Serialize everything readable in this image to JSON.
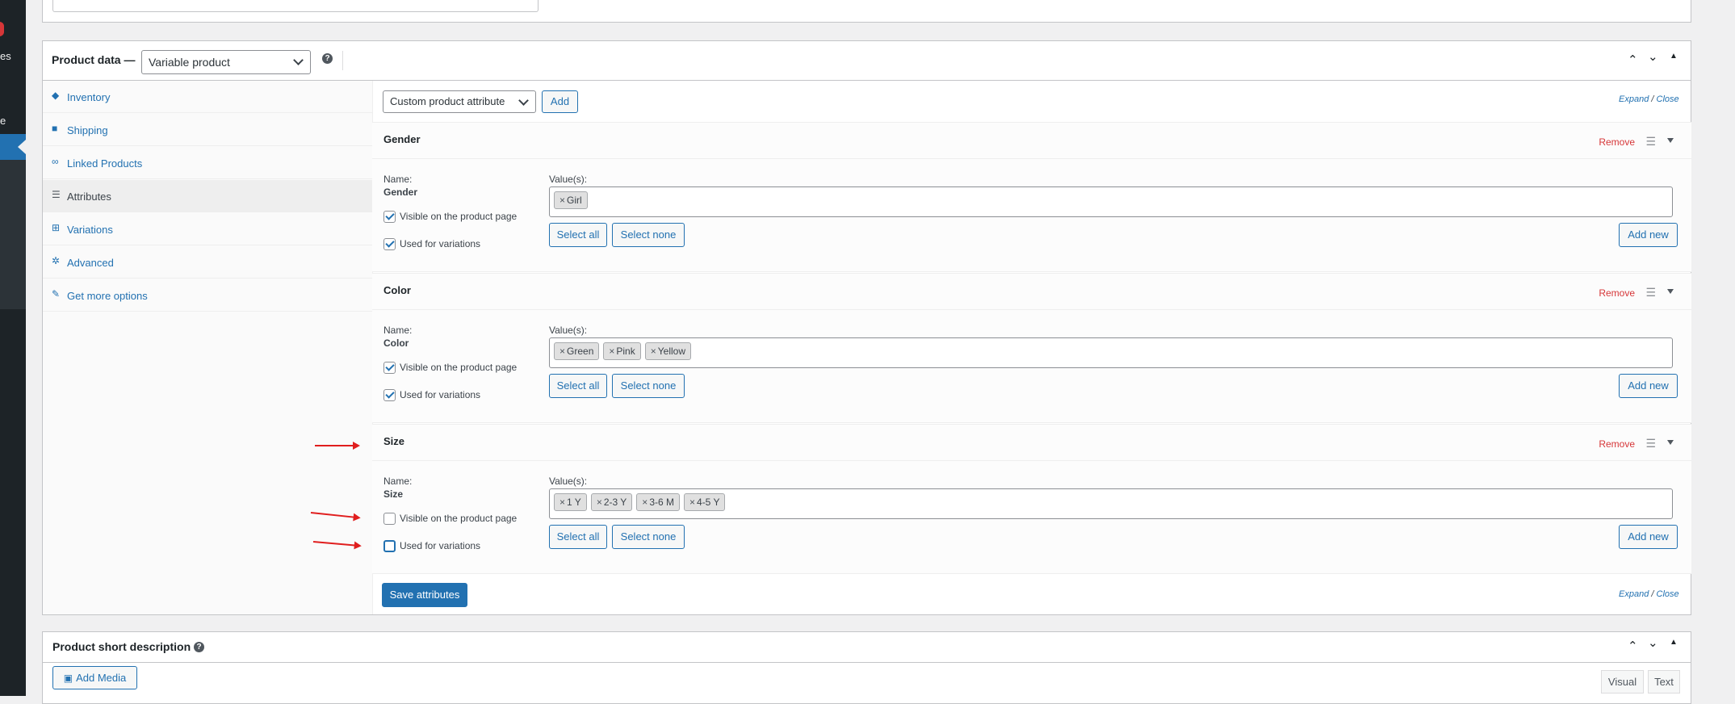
{
  "sidebar": {
    "fragment_1": "es",
    "fragment_2": "e"
  },
  "product_data": {
    "title": "Product data —",
    "type_select": "Variable product",
    "help": "?",
    "tabs": [
      {
        "label": "Inventory",
        "icon": "◆"
      },
      {
        "label": "Shipping",
        "icon": "■"
      },
      {
        "label": "Linked Products",
        "icon": "∞"
      },
      {
        "label": "Attributes",
        "icon": "☰"
      },
      {
        "label": "Variations",
        "icon": "⊞"
      },
      {
        "label": "Advanced",
        "icon": "✲"
      },
      {
        "label": "Get more options",
        "icon": "✎"
      }
    ],
    "attribute_select": "Custom product attribute",
    "add_label": "Add",
    "expand_label": "Expand",
    "slash": "/",
    "close_label": "Close",
    "save_label": "Save attributes",
    "attributes": [
      {
        "name": "Gender",
        "remove": "Remove",
        "name_label": "Name:",
        "values_label": "Value(s):",
        "values": [
          "Girl"
        ],
        "visible_label": "Visible on the product page",
        "visible": true,
        "variations_label": "Used for variations",
        "variations": true,
        "select_all": "Select all",
        "select_none": "Select none",
        "add_new": "Add new"
      },
      {
        "name": "Color",
        "remove": "Remove",
        "name_label": "Name:",
        "values_label": "Value(s):",
        "values": [
          "Green",
          "Pink",
          "Yellow"
        ],
        "visible_label": "Visible on the product page",
        "visible": true,
        "variations_label": "Used for variations",
        "variations": true,
        "select_all": "Select all",
        "select_none": "Select none",
        "add_new": "Add new"
      },
      {
        "name": "Size",
        "remove": "Remove",
        "name_label": "Name:",
        "values_label": "Value(s):",
        "values": [
          "1 Y",
          "2-3 Y",
          "3-6 M",
          "4-5 Y"
        ],
        "visible_label": "Visible on the product page",
        "visible": false,
        "variations_label": "Used for variations",
        "variations": false,
        "select_all": "Select all",
        "select_none": "Select none",
        "add_new": "Add new"
      }
    ]
  },
  "short_description": {
    "title": "Product short description",
    "help": "?",
    "add_media": "Add Media",
    "tab_visual": "Visual",
    "tab_text": "Text"
  },
  "colors": {
    "accent": "#2271b1",
    "danger": "#d63638",
    "annotation_arrow": "#e01e1e",
    "admin_sidebar": "#1d2327"
  }
}
